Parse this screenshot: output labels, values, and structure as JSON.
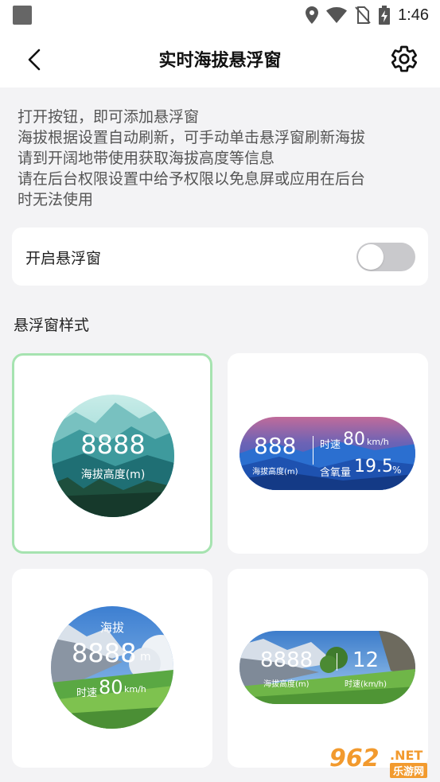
{
  "status_bar": {
    "time": "1:46",
    "icons": [
      "app-icon",
      "location-icon",
      "wifi-icon",
      "no-sim-icon",
      "battery-charging-icon"
    ]
  },
  "header": {
    "title": "实时海拔悬浮窗",
    "back_icon": "back-arrow-icon",
    "settings_icon": "gear-icon"
  },
  "info_lines": [
    "打开按钮，即可添加悬浮窗",
    "海拔根据设置自动刷新，可手动单击悬浮窗刷新海拔",
    "请到开阔地带使用获取海拔高度等信息",
    "请在后台权限设置中给予权限以免息屏或应用在后台",
    "时无法使用"
  ],
  "toggle": {
    "label": "开启悬浮窗",
    "enabled": false
  },
  "styles_section": {
    "title": "悬浮窗样式",
    "selected_index": 0,
    "selected_border_color": "#a6e3b0",
    "cards": [
      {
        "altitude": "8888",
        "altitude_label": "海拔高度(m)"
      },
      {
        "altitude": "888",
        "altitude_label": "海拔高度(m)",
        "speed_label": "时速",
        "speed": "80",
        "speed_unit": "km/h",
        "oxygen_label": "含氧量",
        "oxygen": "19.5",
        "oxygen_unit": "%"
      },
      {
        "title": "海拔",
        "altitude": "8888",
        "altitude_unit": "m",
        "speed_label": "时速",
        "speed": "80",
        "speed_unit": "km/h"
      },
      {
        "altitude": "8888",
        "altitude_label": "海拔高度(m)",
        "speed": "12",
        "speed_label": "时速(km/h)"
      }
    ]
  },
  "watermark": {
    "number": "962",
    "domain": ".NET",
    "sub": "乐游网"
  }
}
